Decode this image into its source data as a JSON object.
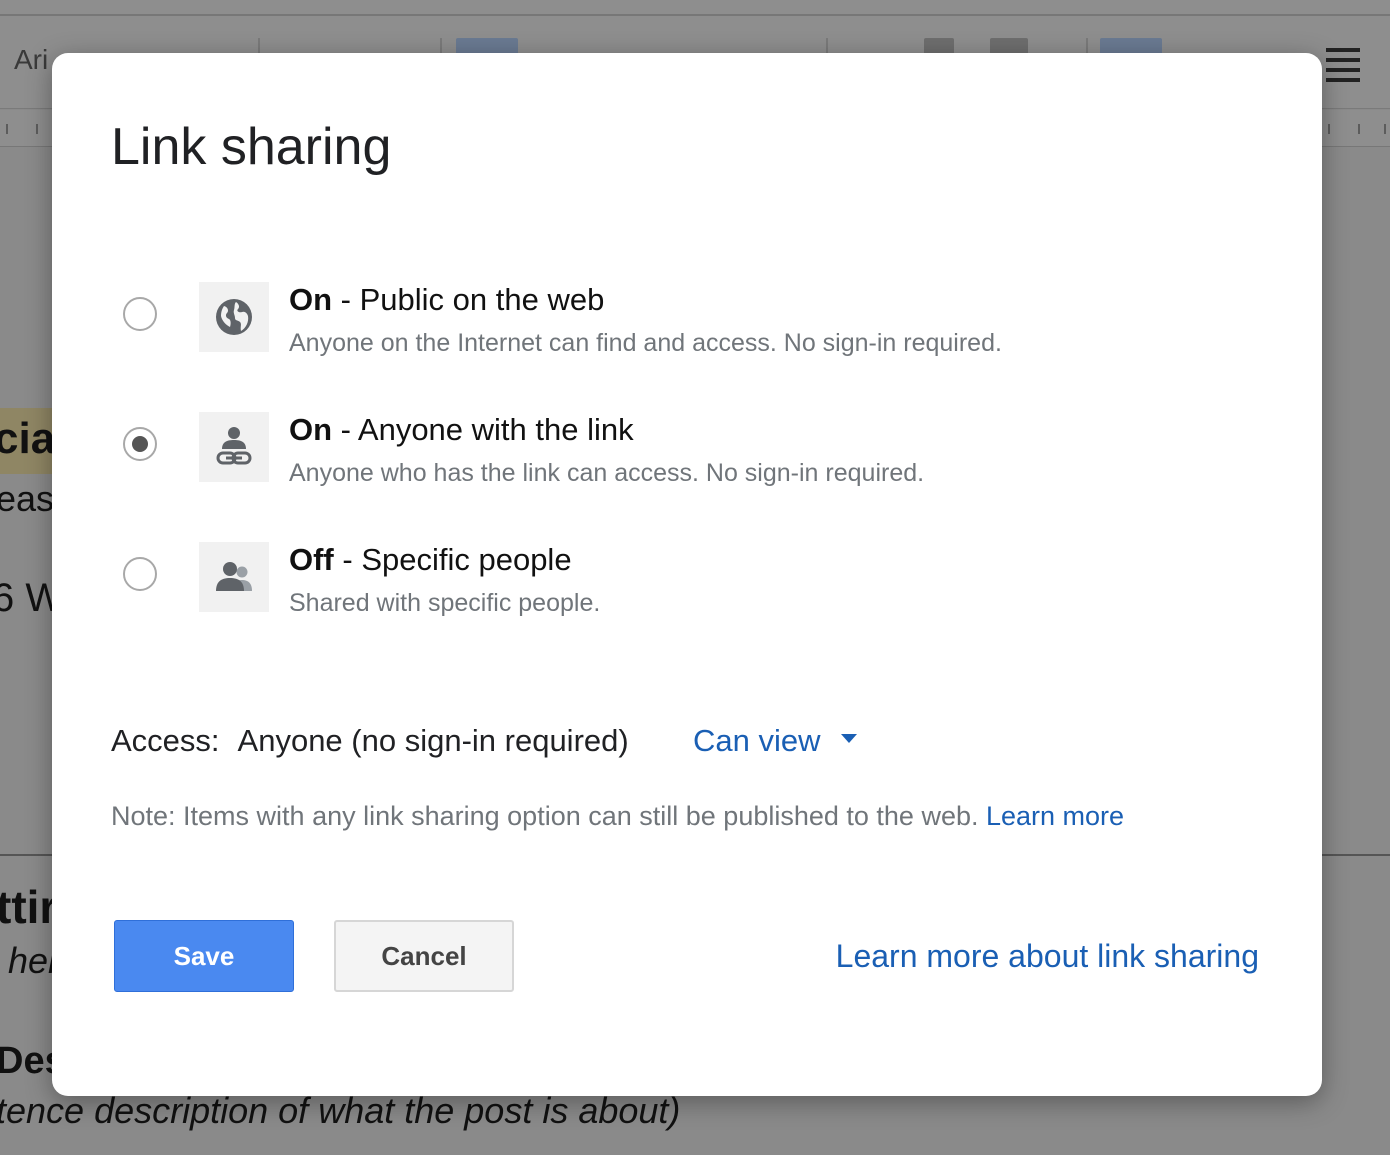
{
  "background": {
    "font_name": "Ari",
    "heading_fragment": "cial",
    "text_fragment_1": "east",
    "text_fragment_2": "6 W",
    "heading_fragment_2": "ttir",
    "italic_fragment_1": "her",
    "heading_fragment_3": "Des",
    "italic_fragment_2": "tence description of what the post is about)"
  },
  "dialog": {
    "title": "Link sharing",
    "options": [
      {
        "state": "On",
        "label": " - Public on the web",
        "description": "Anyone on the Internet can find and access. No sign-in required.",
        "icon": "globe-icon",
        "checked": false
      },
      {
        "state": "On",
        "label": " - Anyone with the link",
        "description": "Anyone who has the link can access. No sign-in required.",
        "icon": "person-link-icon",
        "checked": true
      },
      {
        "state": "Off",
        "label": " - Specific people",
        "description": "Shared with specific people.",
        "icon": "people-icon",
        "checked": false
      }
    ],
    "access": {
      "label": "Access:",
      "who": "Anyone (no sign-in required)",
      "permission": "Can view"
    },
    "note": {
      "text": "Note: Items with any link sharing option can still be published to the web. ",
      "link": "Learn more"
    },
    "buttons": {
      "save": "Save",
      "cancel": "Cancel"
    },
    "learn_more_link": "Learn more about link sharing"
  },
  "colors": {
    "accent": "#1a5fb4",
    "save_button": "#4a89f0",
    "muted_text": "#70757a",
    "overlay": "#8a8a8a"
  }
}
